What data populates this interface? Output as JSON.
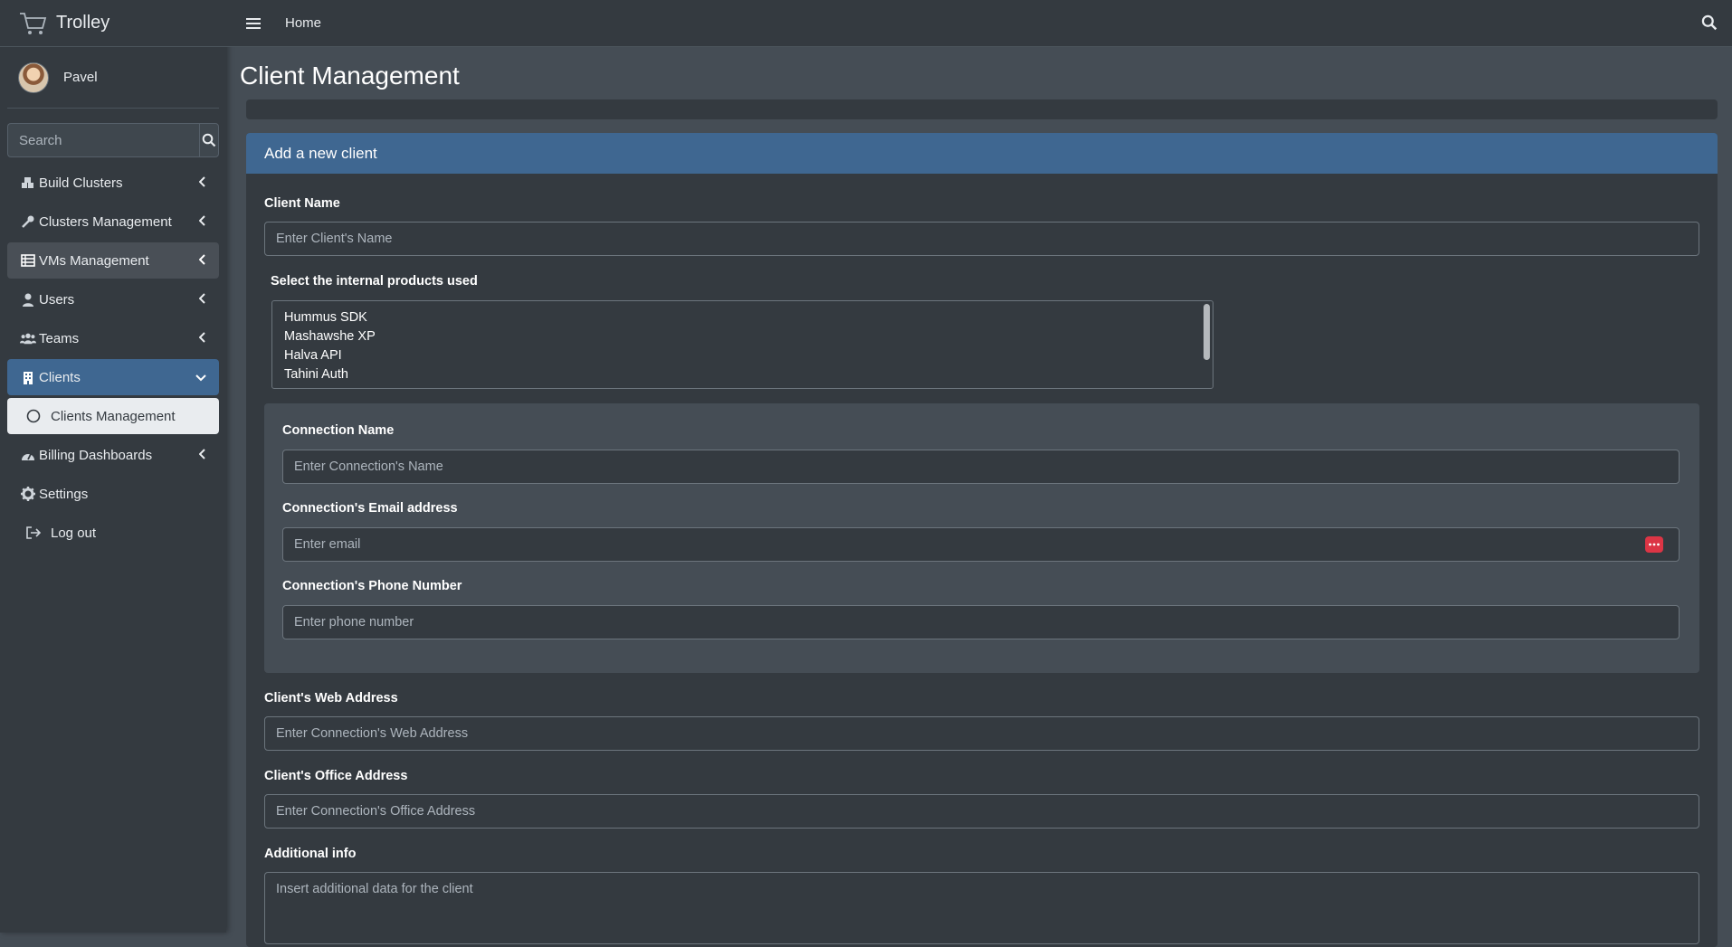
{
  "brand": {
    "name": "Trolley",
    "icon": "cart-icon"
  },
  "user": {
    "name": "Pavel"
  },
  "sidebar": {
    "search_placeholder": "Search",
    "items": [
      {
        "label": "Build Clusters",
        "icon": "cubes-icon"
      },
      {
        "label": "Clusters Management",
        "icon": "wrench-icon"
      },
      {
        "label": "VMs Management",
        "icon": "server-icon"
      },
      {
        "label": "Users",
        "icon": "user-icon"
      },
      {
        "label": "Teams",
        "icon": "users-icon"
      },
      {
        "label": "Clients",
        "icon": "building-icon"
      },
      {
        "label": "Clients Management",
        "icon": "circle-icon"
      },
      {
        "label": "Billing Dashboards",
        "icon": "gauge-icon"
      },
      {
        "label": "Settings",
        "icon": "gear-icon"
      },
      {
        "label": "Log out",
        "icon": "logout-icon"
      }
    ]
  },
  "topbar": {
    "home_label": "Home"
  },
  "page": {
    "title": "Client Management"
  },
  "form": {
    "card_title": "Add a new client",
    "client_name": {
      "label": "Client Name",
      "placeholder": "Enter Client's Name"
    },
    "products": {
      "label": "Select the internal products used",
      "options": [
        "Hummus SDK",
        "Mashawshe XP",
        "Halva API",
        "Tahini Auth"
      ]
    },
    "connection_name": {
      "label": "Connection Name",
      "placeholder": "Enter Connection's Name"
    },
    "connection_email": {
      "label": "Connection's Email address",
      "placeholder": "Enter email"
    },
    "connection_phone": {
      "label": "Connection's Phone Number",
      "placeholder": "Enter phone number"
    },
    "web_address": {
      "label": "Client's Web Address",
      "placeholder": "Enter Connection's Web Address"
    },
    "office_address": {
      "label": "Client's Office Address",
      "placeholder": "Enter Connection's Office Address"
    },
    "additional_info": {
      "label": "Additional info",
      "placeholder": "Insert additional data for the client"
    }
  },
  "colors": {
    "sidebar_bg": "#343a40",
    "content_bg": "#454d55",
    "accent_blue": "#3f6791",
    "danger": "#dc3545"
  }
}
